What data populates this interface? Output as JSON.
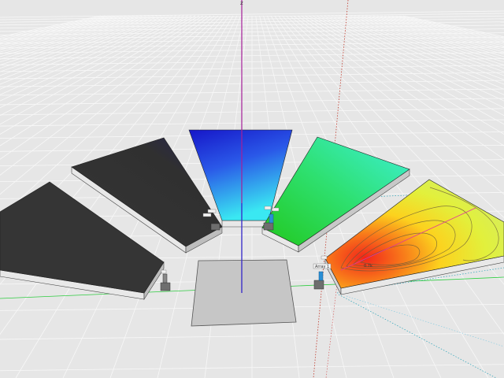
{
  "scene": {
    "background_color": "#e6e6e6",
    "grid_color": "#f7f7f7",
    "axes": {
      "vertical_label": "z",
      "vertical_color": "#a51e9a",
      "horizontal_color": "#2ecc40",
      "red_axis_color": "#c0392b",
      "guide_color": "#29a3b8"
    },
    "panels": [
      {
        "name": "panel-1",
        "fill": "dark-gray",
        "color": "#3a3a3a"
      },
      {
        "name": "panel-2",
        "fill": "dark-gray",
        "color": "#333333"
      },
      {
        "name": "panel-3",
        "fill": "blue-cyan-gradient",
        "colors": [
          "#1a1ad0",
          "#38e6f0"
        ]
      },
      {
        "name": "panel-4",
        "fill": "green-cyan-gradient",
        "colors": [
          "#1fcf2e",
          "#3af0c8"
        ]
      },
      {
        "name": "panel-5",
        "fill": "heatmap-contours",
        "colors": [
          "#f22a1a",
          "#ffd21a",
          "#e4f04a"
        ]
      }
    ],
    "base_plate_color": "#c4c4c4",
    "sensors": [
      "sensor-1",
      "sensor-2",
      "sensor-3",
      "sensor-4"
    ],
    "labels": {
      "array_tag": "Array 1"
    }
  }
}
